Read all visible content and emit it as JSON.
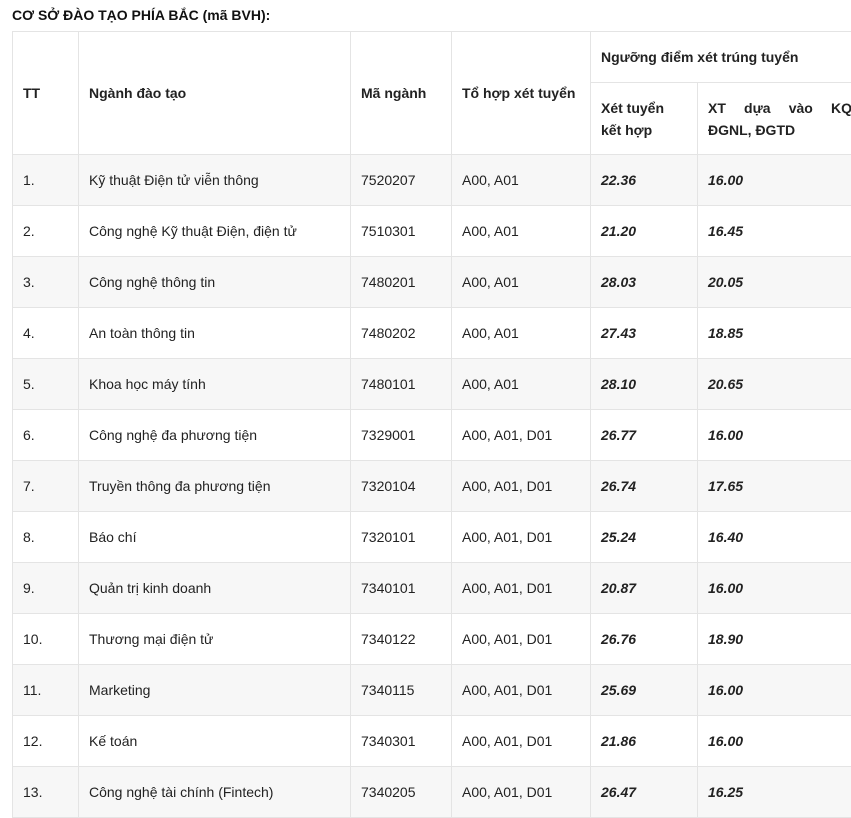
{
  "heading": "CƠ SỞ ĐÀO TẠO PHÍA BẮC (mã BVH):",
  "table": {
    "headers": {
      "tt": "TT",
      "major": "Ngành đào tạo",
      "code": "Mã ngành",
      "combo": "Tổ hợp xét tuyển",
      "threshold": "Ngưỡng điểm xét trúng tuyển",
      "combined": "Xét tuyển kết hợp",
      "dgnl": "XT dựa vào KQ ĐGNL, ĐGTD"
    },
    "rows": [
      {
        "tt": "1.",
        "major": "Kỹ thuật Điện tử viễn thông",
        "code": "7520207",
        "combo": "A00, A01",
        "combined": "22.36",
        "dgnl": "16.00"
      },
      {
        "tt": "2.",
        "major": "Công nghệ Kỹ thuật Điện, điện tử",
        "code": "7510301",
        "combo": "A00, A01",
        "combined": "21.20",
        "dgnl": "16.45"
      },
      {
        "tt": "3.",
        "major": "Công nghệ thông tin",
        "code": "7480201",
        "combo": "A00, A01",
        "combined": "28.03",
        "dgnl": "20.05"
      },
      {
        "tt": "4.",
        "major": "An toàn thông tin",
        "code": "7480202",
        "combo": "A00, A01",
        "combined": "27.43",
        "dgnl": "18.85"
      },
      {
        "tt": "5.",
        "major": "Khoa học máy tính",
        "code": "7480101",
        "combo": "A00, A01",
        "combined": "28.10",
        "dgnl": "20.65"
      },
      {
        "tt": "6.",
        "major": "Công nghệ đa phương tiện",
        "code": "7329001",
        "combo": "A00, A01, D01",
        "combined": "26.77",
        "dgnl": "16.00"
      },
      {
        "tt": "7.",
        "major": "Truyền thông đa phương tiện",
        "code": "7320104",
        "combo": "A00, A01, D01",
        "combined": "26.74",
        "dgnl": "17.65"
      },
      {
        "tt": "8.",
        "major": "Báo chí",
        "code": "7320101",
        "combo": "A00, A01, D01",
        "combined": "25.24",
        "dgnl": "16.40"
      },
      {
        "tt": "9.",
        "major": "Quản trị kinh doanh",
        "code": "7340101",
        "combo": "A00, A01, D01",
        "combined": "20.87",
        "dgnl": "16.00"
      },
      {
        "tt": "10.",
        "major": "Thương mại điện tử",
        "code": "7340122",
        "combo": "A00, A01, D01",
        "combined": "26.76",
        "dgnl": "18.90"
      },
      {
        "tt": "11.",
        "major": "Marketing",
        "code": "7340115",
        "combo": "A00, A01, D01",
        "combined": "25.69",
        "dgnl": "16.00"
      },
      {
        "tt": "12.",
        "major": "Kế toán",
        "code": "7340301",
        "combo": "A00, A01, D01",
        "combined": "21.86",
        "dgnl": "16.00"
      },
      {
        "tt": "13.",
        "major": "Công nghệ tài chính (Fintech)",
        "code": "7340205",
        "combo": "A00, A01, D01",
        "combined": "26.47",
        "dgnl": "16.25"
      }
    ]
  }
}
